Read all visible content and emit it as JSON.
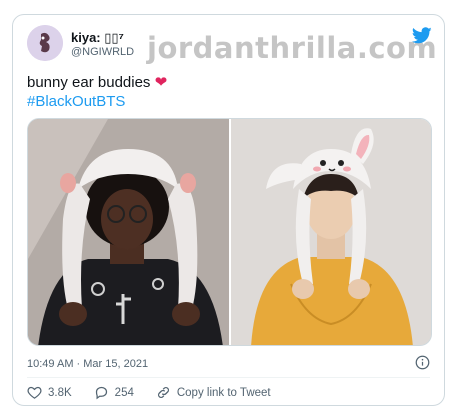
{
  "tweet": {
    "display_name": "kiya: ▯▯⁷",
    "handle": "@NGIWRLD",
    "watermark": "jordanthrilla.com",
    "text": "bunny ear buddies",
    "heart_emoji": "❤",
    "hashtag": "#BlackOutBTS",
    "timestamp": "10:49 AM · Mar 15, 2021",
    "likes": "3.8K",
    "replies": "254",
    "copy_link_label": "Copy link to Tweet"
  },
  "colors": {
    "link": "#1d9bf0",
    "heart": "#e0245e",
    "twitter_brand": "#1d9bf0",
    "muted": "#536471"
  },
  "icons": [
    "twitter-bird-icon",
    "info-icon",
    "heart-icon",
    "reply-icon",
    "link-icon"
  ]
}
